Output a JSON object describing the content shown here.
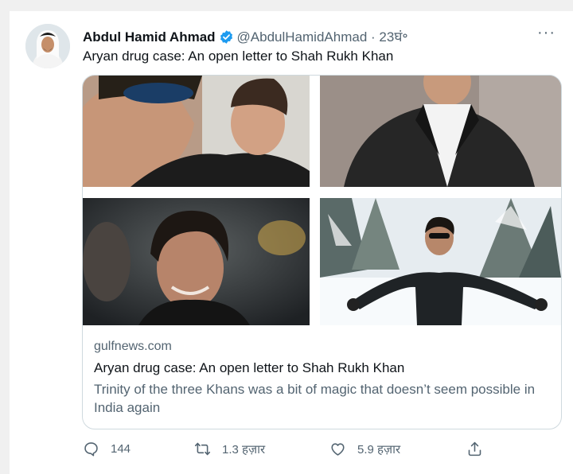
{
  "tweet": {
    "author_name": "Abdul Hamid Ahmad",
    "handle": "@AbdulHamidAhmad",
    "separator": "·",
    "time": "23घं॰",
    "more": "···",
    "text": "Aryan drug case: An open letter to Shah Rukh Khan"
  },
  "card": {
    "domain": "gulfnews.com",
    "title": "Aryan drug case: An open letter to Shah Rukh Khan",
    "description": "Trinity of the three Khans was a bit of magic that doesn’t seem possible in India again"
  },
  "actions": {
    "reply_count": "144",
    "retweet_count": "1.3 हज़ार",
    "like_count": "5.9 हज़ार"
  },
  "colors": {
    "verified": "#1d9bf0",
    "secondary_text": "#536471",
    "primary_text": "#0f1419",
    "border": "#cfd9de"
  }
}
